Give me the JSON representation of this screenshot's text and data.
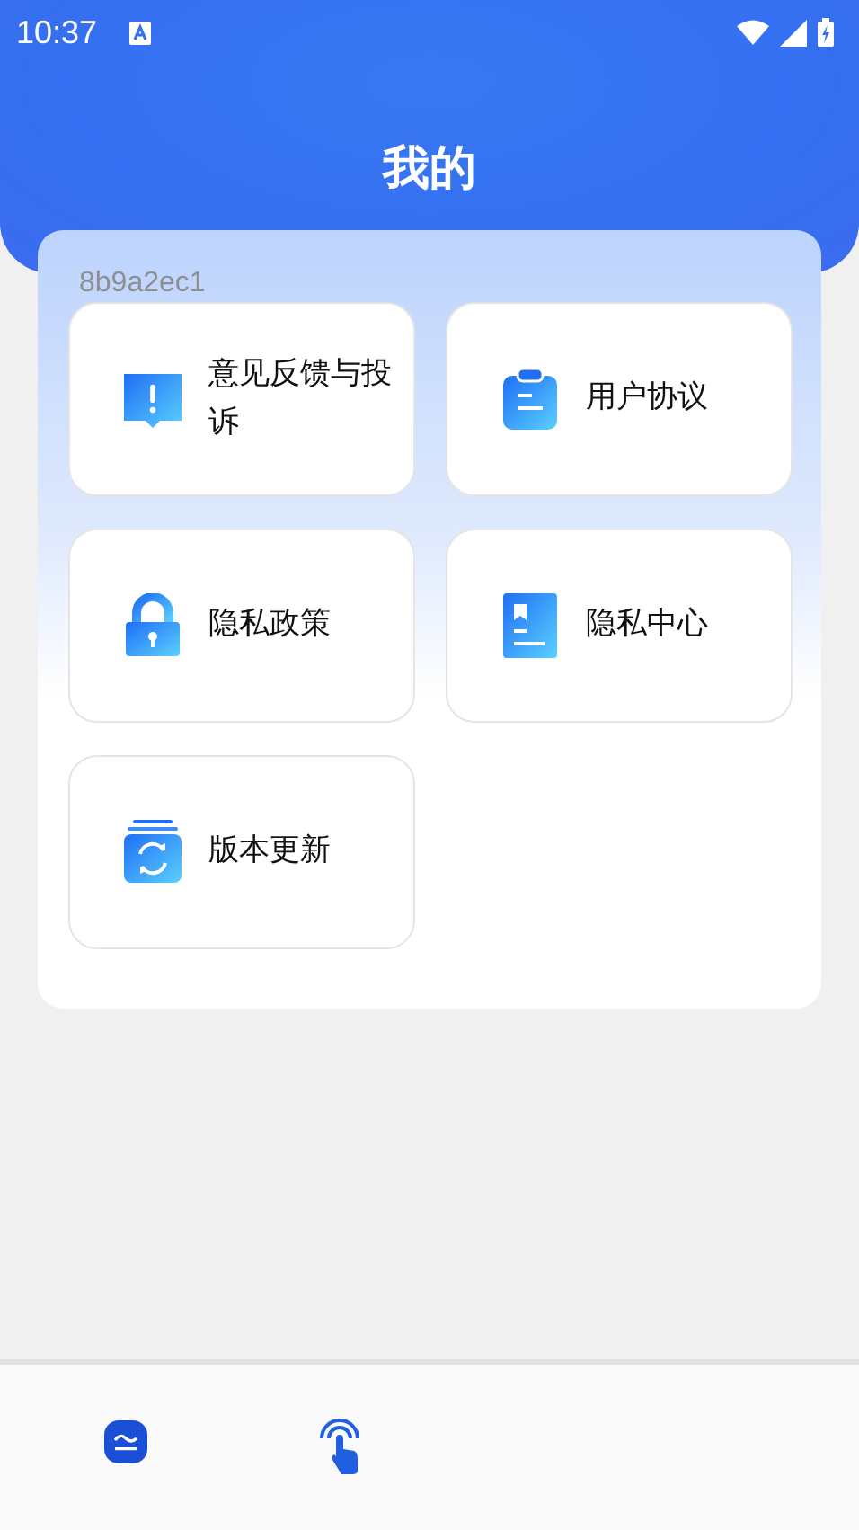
{
  "status_bar": {
    "time": "10:37"
  },
  "header": {
    "title": "我的"
  },
  "user_id": "8b9a2ec1",
  "menu": [
    {
      "label": "意见反馈与投诉",
      "kind": "feedback"
    },
    {
      "label": "用户协议",
      "kind": "clipboard"
    },
    {
      "label": "隐私政策",
      "kind": "lock"
    },
    {
      "label": "隐私中心",
      "kind": "document"
    },
    {
      "label": "版本更新",
      "kind": "update"
    }
  ],
  "bottom_nav": [
    {
      "kind": "home"
    },
    {
      "kind": "touch"
    }
  ]
}
